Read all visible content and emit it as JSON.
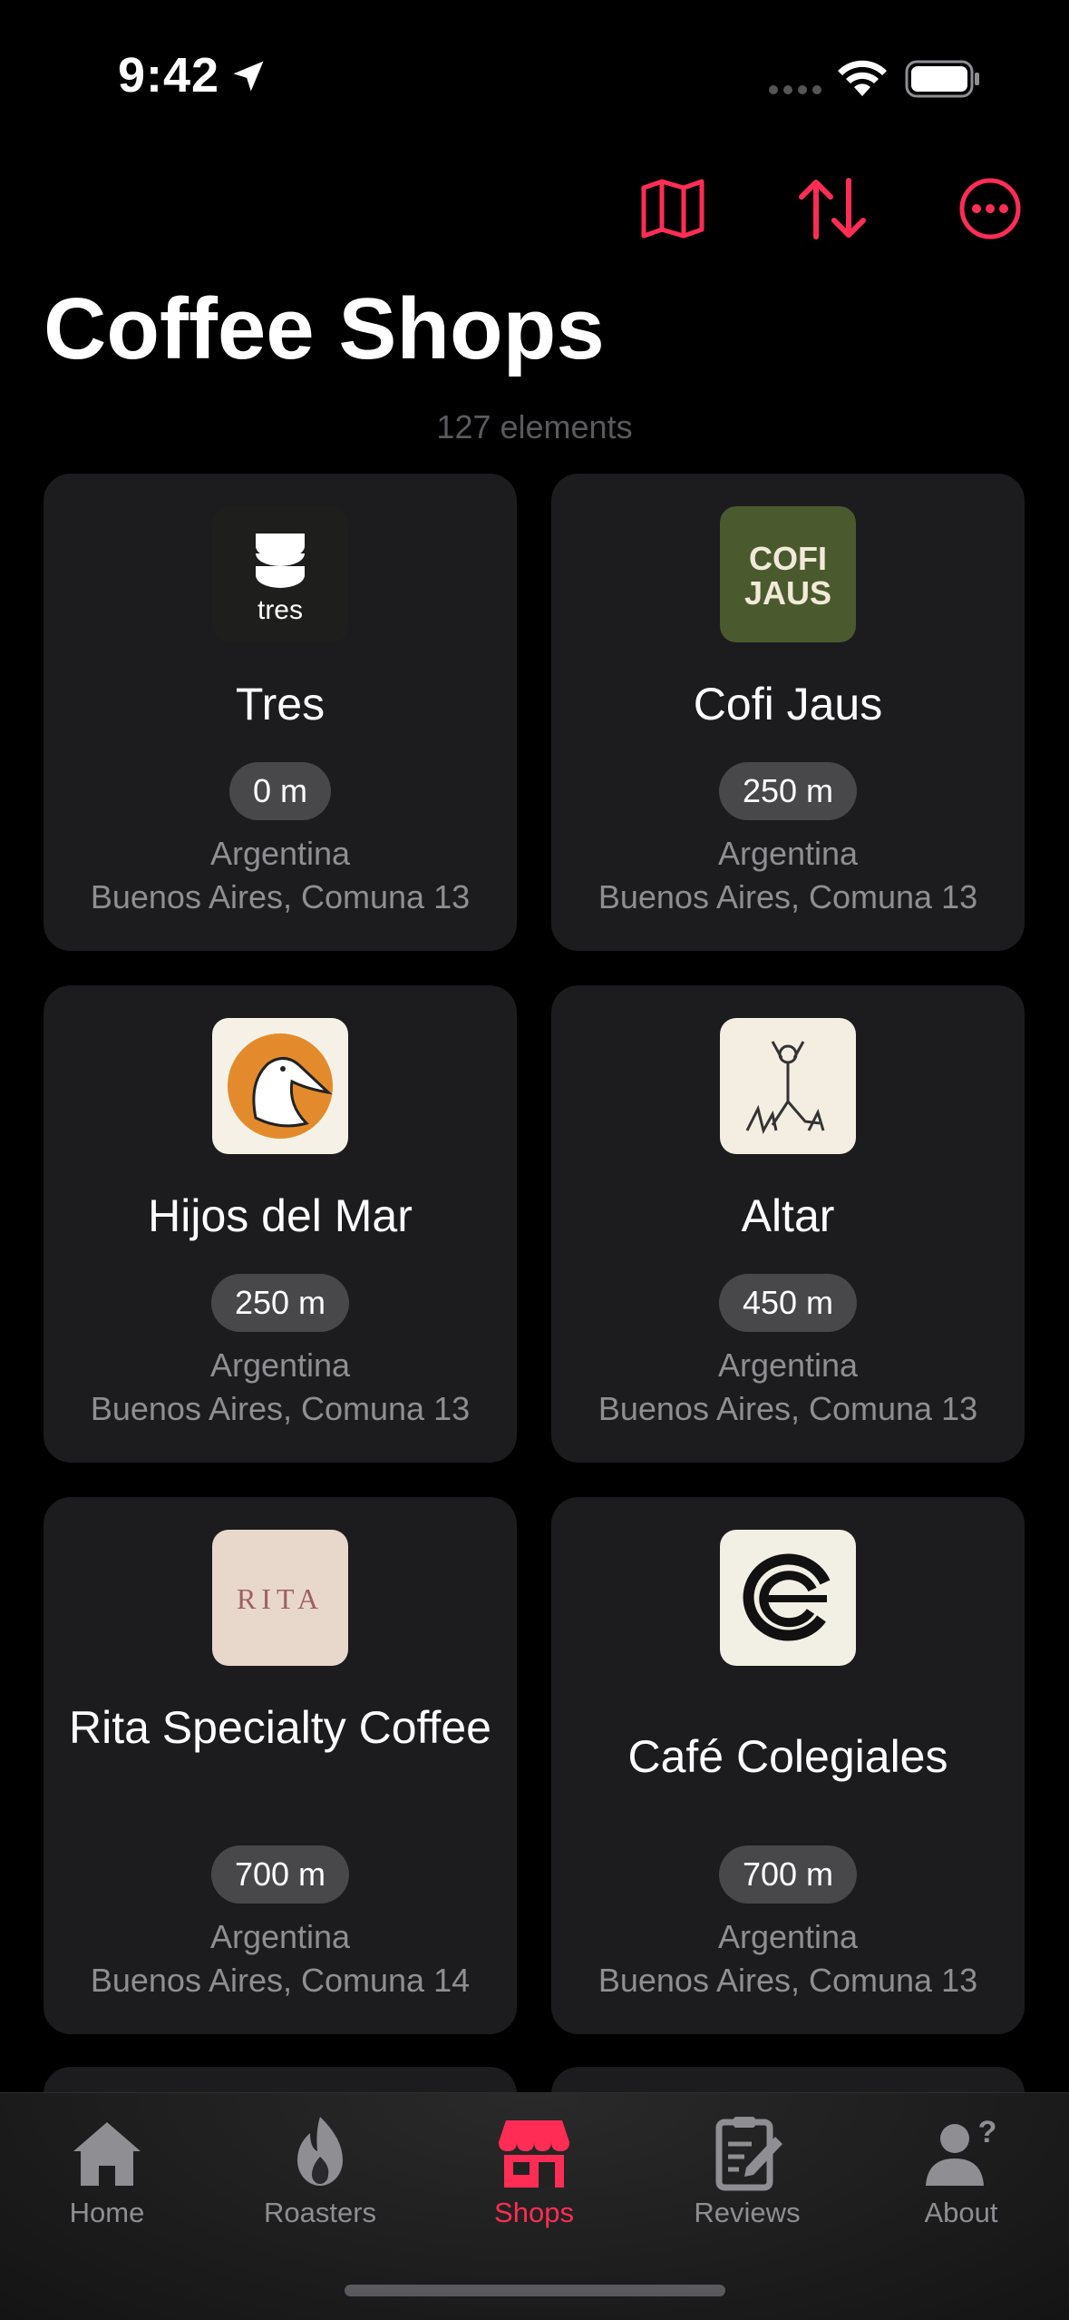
{
  "status_bar": {
    "time": "9:42"
  },
  "header": {
    "title": "Coffee Shops",
    "count_text": "127 elements"
  },
  "toolbar": {
    "map_icon": "map-icon",
    "sort_icon": "sort-arrows-icon",
    "more_icon": "ellipsis-circle-icon"
  },
  "shops": [
    {
      "name": "Tres",
      "distance": "0 m",
      "country": "Argentina",
      "city": "Buenos Aires, Comuna 13",
      "logo_text": "tres"
    },
    {
      "name": "Cofi Jaus",
      "distance": "250 m",
      "country": "Argentina",
      "city": "Buenos Aires, Comuna 13",
      "logo_text": "COFI JAUS"
    },
    {
      "name": "Hijos del Mar",
      "distance": "250 m",
      "country": "Argentina",
      "city": "Buenos Aires, Comuna 13"
    },
    {
      "name": "Altar",
      "distance": "450 m",
      "country": "Argentina",
      "city": "Buenos Aires, Comuna 13"
    },
    {
      "name": "Rita Specialty Coffee",
      "distance": "700 m",
      "country": "Argentina",
      "city": "Buenos Aires, Comuna 14",
      "logo_text": "RITA"
    },
    {
      "name": "Café Colegiales",
      "distance": "700 m",
      "country": "Argentina",
      "city": "Buenos Aires, Comuna 13"
    }
  ],
  "tabs": [
    {
      "label": "Home",
      "icon": "house-icon",
      "active": false
    },
    {
      "label": "Roasters",
      "icon": "flame-icon",
      "active": false
    },
    {
      "label": "Shops",
      "icon": "storefront-icon",
      "active": true
    },
    {
      "label": "Reviews",
      "icon": "clipboard-pen-icon",
      "active": false
    },
    {
      "label": "About",
      "icon": "person-question-icon",
      "active": false
    }
  ],
  "colors": {
    "accent": "#ff2d55",
    "card_bg": "#1c1c1e",
    "pill_bg": "#48484a",
    "secondary_text": "#8e8e93"
  }
}
